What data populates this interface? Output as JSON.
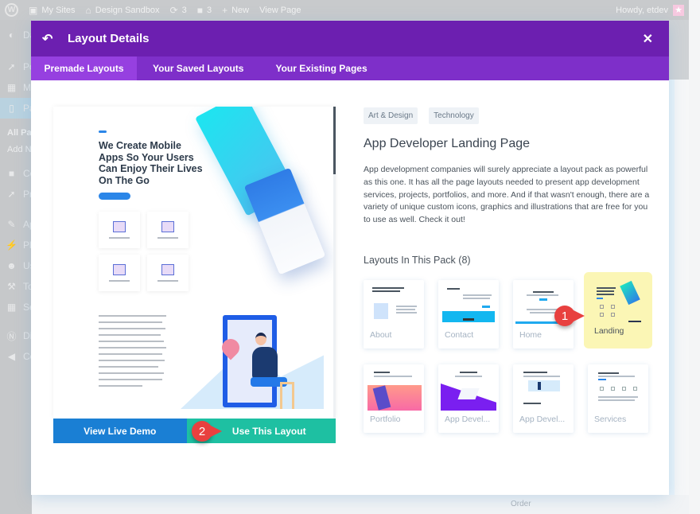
{
  "adminbar": {
    "items": [
      {
        "icon": "wordpress-logo-icon",
        "label": ""
      },
      {
        "icon": "my-sites-icon",
        "label": "My Sites"
      },
      {
        "icon": "home-icon",
        "label": "Design Sandbox"
      },
      {
        "icon": "updates-icon",
        "label": "3"
      },
      {
        "icon": "comments-icon",
        "label": "3"
      },
      {
        "icon": "plus-icon",
        "label": "New"
      },
      {
        "icon": "",
        "label": "View Page"
      }
    ],
    "greeting": "Howdy, etdev"
  },
  "sidebar": {
    "items": [
      {
        "icon": "dashboard-icon",
        "label": "Dashboard"
      },
      {
        "icon": "pin-icon",
        "label": "Posts"
      },
      {
        "icon": "media-icon",
        "label": "Media"
      },
      {
        "icon": "pages-icon",
        "label": "Pages"
      },
      {
        "icon": "comments-icon",
        "label": "Comments"
      },
      {
        "icon": "pin-icon",
        "label": "Projects"
      },
      {
        "icon": "appearance-icon",
        "label": "Appearance"
      },
      {
        "icon": "plugins-icon",
        "label": "Plugins"
      },
      {
        "icon": "users-icon",
        "label": "Users"
      },
      {
        "icon": "tools-icon",
        "label": "Tools"
      },
      {
        "icon": "settings-icon",
        "label": "Settings"
      },
      {
        "icon": "divi-icon",
        "label": "Divi"
      },
      {
        "icon": "collapse-icon",
        "label": "Collapse menu"
      }
    ],
    "subitems": [
      "All Pages",
      "Add New"
    ]
  },
  "background": {
    "order_label": "Order"
  },
  "modal": {
    "title": "Layout Details",
    "tabs": [
      "Premade Layouts",
      "Your Saved Layouts",
      "Your Existing Pages"
    ],
    "active_tab": 0,
    "preview": {
      "headline": "We Create Mobile Apps So Your Users Can Enjoy Their Lives On The Go",
      "view_demo_label": "View Live Demo",
      "use_layout_label": "Use This Layout"
    },
    "tags": [
      "Art & Design",
      "Technology"
    ],
    "layout_title": "App Developer Landing Page",
    "description": "App development companies will surely appreciate a layout pack as powerful as this one. It has all the page layouts needed to present app development services, projects, portfolios, and more. And if that wasn't enough, there are a variety of unique custom icons, graphics and illustrations that are free for you to use as well. Check it out!",
    "pack_title": "Layouts In This Pack (8)",
    "layouts": [
      {
        "label": "About",
        "selected": false
      },
      {
        "label": "Contact",
        "selected": false
      },
      {
        "label": "Home",
        "selected": false
      },
      {
        "label": "Landing",
        "selected": true
      },
      {
        "label": "Portfolio",
        "selected": false
      },
      {
        "label": "App Devel...",
        "selected": false
      },
      {
        "label": "App Devel...",
        "selected": false
      },
      {
        "label": "Services",
        "selected": false
      }
    ]
  },
  "annotations": [
    {
      "number": "1",
      "target": "Landing"
    },
    {
      "number": "2",
      "target": "Use This Layout"
    }
  ],
  "colors": {
    "header": "#6c1fb0",
    "tabs": "#7e2fc9",
    "active_tab": "#9640e0",
    "demo_button": "#1a7fd4",
    "use_button": "#1ec0a2",
    "marker": "#e8403f",
    "selected_highlight": "#fbf6b5"
  }
}
